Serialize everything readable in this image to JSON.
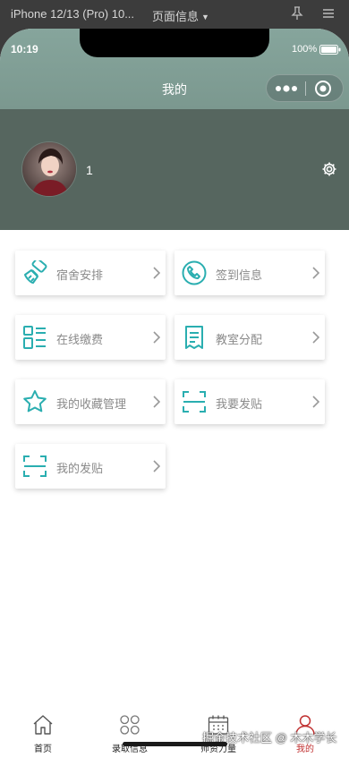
{
  "simulator": {
    "device": "iPhone 12/13 (Pro) 10...",
    "page_info": "页面信息"
  },
  "status_bar": {
    "time": "10:19",
    "battery": "100%"
  },
  "nav": {
    "title": "我的"
  },
  "profile": {
    "username": "1"
  },
  "menu": {
    "items": [
      {
        "label": "宿舍安排",
        "icon": "sweep-icon"
      },
      {
        "label": "签到信息",
        "icon": "phone-icon"
      },
      {
        "label": "在线缴费",
        "icon": "list-icon"
      },
      {
        "label": "教室分配",
        "icon": "receipt-icon"
      },
      {
        "label": "我的收藏管理",
        "icon": "star-icon"
      },
      {
        "label": "我要发贴",
        "icon": "scan-icon"
      },
      {
        "label": "我的发贴",
        "icon": "scan-icon"
      }
    ]
  },
  "tabbar": {
    "items": [
      {
        "label": "首页",
        "icon": "home-icon"
      },
      {
        "label": "录取信息",
        "icon": "grid-icon"
      },
      {
        "label": "师资力量",
        "icon": "calendar-icon"
      },
      {
        "label": "我的",
        "icon": "user-icon"
      }
    ],
    "active_index": 3
  },
  "watermark": "掘金技术社区 @ 木木学长",
  "colors": {
    "accent": "#2aaeb0",
    "header": "#56665f",
    "tab_active": "#c03030"
  }
}
